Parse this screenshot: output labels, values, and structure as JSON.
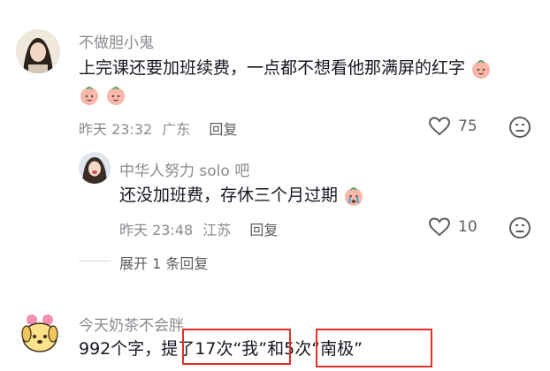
{
  "comments": [
    {
      "username": "不做胆小鬼",
      "text": "上完课还要加班续费，一点都不想看他那满屏的红字",
      "time": "昨天 23:32",
      "location": "广东",
      "reply_label": "回复",
      "likes": "75"
    },
    {
      "username": "中华人努力 solo 吧",
      "text": "还没加班费，存休三个月过期",
      "time": "昨天 23:48",
      "location": "江苏",
      "reply_label": "回复",
      "likes": "10"
    },
    {
      "username": "今天奶茶不会胖",
      "text_parts": [
        "992个字，提了",
        "17次“我”",
        "和",
        "5次“南极”"
      ]
    }
  ],
  "expand_label": "展开 1 条回复",
  "colors": {
    "highlight_box": "#e0302b",
    "meta_gray": "#8a8b91"
  },
  "icons": [
    "heart-icon",
    "neutral-face-icon",
    "peach-face-emoji",
    "crying-emoji"
  ]
}
